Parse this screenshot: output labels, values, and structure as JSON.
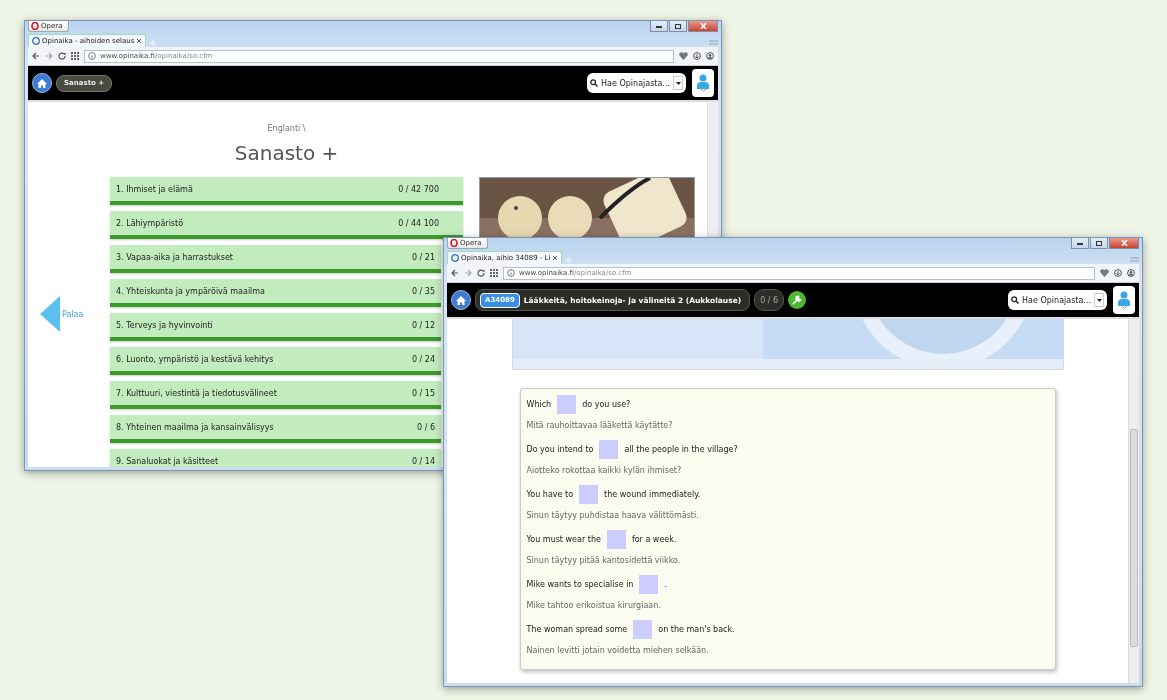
{
  "window_back": {
    "app_title": "Opera",
    "tab": {
      "title": "Opinaika - aihoiden selaus"
    },
    "url": {
      "host": "www.opinaika.fi",
      "path": "/opinaika/so.cfm"
    },
    "header": {
      "menu_label": "Sanasto +",
      "search_placeholder": "Hae Opinajasta..."
    },
    "breadcrumb": "Englanti \\",
    "title": "Sanasto +",
    "back_label": "Palaa",
    "topics": [
      {
        "label": "1. Ihmiset ja elämä",
        "count": "0 / 42 700"
      },
      {
        "label": "2. Lähiympäristö",
        "count": "0 / 44 100"
      },
      {
        "label": "3. Vapaa-aika ja harrastukset",
        "count": "0 / 21"
      },
      {
        "label": "4. Yhteiskunta ja ympäröivä maailma",
        "count": "0 / 35"
      },
      {
        "label": "5. Terveys ja hyvinvointi",
        "count": "0 / 12"
      },
      {
        "label": "6. Luonto, ympäristö ja kestävä kehitys",
        "count": "0 / 24"
      },
      {
        "label": "7. Kulttuuri, viestintä ja tiedotusvälineet",
        "count": "0 / 15"
      },
      {
        "label": "8. Yhteinen maailma ja kansainvälisyys",
        "count": "0 / 6"
      },
      {
        "label": "9. Sanaluokat ja käsitteet",
        "count": "0 / 14"
      }
    ]
  },
  "window_front": {
    "app_title": "Opera",
    "tab": {
      "title": "Opinaika, aihio 34089 - Li"
    },
    "url": {
      "host": "www.opinaika.fi",
      "path": "/opinaika/so.cfm"
    },
    "header": {
      "code": "A34089",
      "exercise_title": "Lääkkeitä, hoitokeinoja- ja välineitä 2 (Aukkolause)",
      "progress": "0 / 6",
      "search_placeholder": "Hae Opinajasta..."
    },
    "sentences": [
      {
        "before": "Which",
        "after": "do you use?",
        "translation": "Mitä rauhoittavaa lääkettä käytätte?"
      },
      {
        "before": "Do you intend to",
        "after": "all the people in the village?",
        "translation": "Aiotteko rokottaa kaikki kylän ihmiset?"
      },
      {
        "before": "You have to",
        "after": "the wound immediately.",
        "translation": "Sinun täytyy puhdistaa haava välittömästi."
      },
      {
        "before": "You must wear the",
        "after": "for a week.",
        "translation": "Sinun täytyy pitää kantosidettä viikko."
      },
      {
        "before": "Mike wants to specialise in",
        "after": ".",
        "translation": "Mike tahtoo erikoistua kirurgiaan."
      },
      {
        "before": "The woman spread some",
        "after": "on the man's back.",
        "translation": "Nainen levitti jotain voidetta miehen selkään."
      }
    ]
  }
}
